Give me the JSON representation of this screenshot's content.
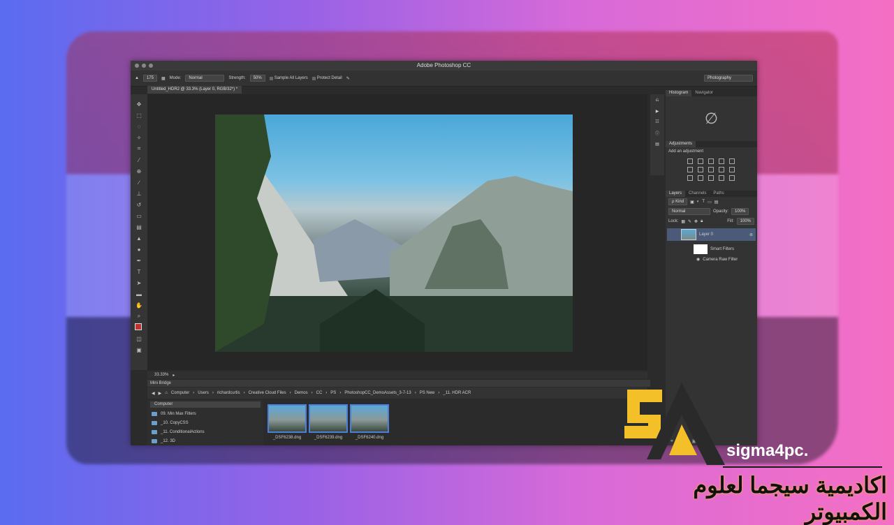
{
  "app": {
    "title": "Adobe Photoshop CC",
    "workspace": "Photography"
  },
  "options": {
    "brush_size": "175",
    "mode_label": "Mode:",
    "mode_value": "Normal",
    "strength_label": "Strength:",
    "strength_value": "50%",
    "sample_all_layers": "Sample All Layers",
    "protect_detail": "Protect Detail"
  },
  "document": {
    "tab": "Untitled_HDR2 @ 33.3% (Layer 0, RGB/32*) *",
    "zoom": "33.33%"
  },
  "mini_bridge": {
    "tab": "Mini Bridge",
    "path": [
      "Computer",
      "Users",
      "richardcurtis",
      "Creative Cloud Files",
      "Demos",
      "CC",
      "PS",
      "PhotoshopCC_DemoAssets_3-7-13",
      "PS New",
      "_11. HDR ACR"
    ],
    "source_header": "Computer",
    "folders": [
      "09. Min Max Filters",
      "_10. CopyCSS",
      "_11. ConditionalActions",
      "_12. 3D"
    ],
    "thumbnails": [
      "_DSF6238.dng",
      "_DSF6239.dng",
      "_DSF6240.dng"
    ]
  },
  "panels": {
    "top_tabs": [
      "Histogram",
      "Navigator"
    ],
    "hist_icon": "∅",
    "adjustments_tab": "Adjustments",
    "adjustments_hint": "Add an adjustment",
    "layer_tabs": [
      "Layers",
      "Channels",
      "Paths"
    ],
    "filter_kind": "ρ Kind",
    "blend_mode": "Normal",
    "opacity_label": "Opacity:",
    "opacity_value": "100%",
    "lock_label": "Lock:",
    "fill_label": "Fill:",
    "fill_value": "100%",
    "layers": {
      "layer0": "Layer 0",
      "smart_filters": "Smart Filters",
      "camera_raw": "Camera Raw Filter"
    }
  },
  "branding": {
    "site": "sigma4pc.",
    "arabic": "اكاديمية سيجما لعلوم الكمبيوتر",
    "logo_letters": "SA"
  },
  "colors": {
    "logo_yellow": "#f4c02a",
    "logo_dark": "#2a2a2a",
    "selection_blue": "#4b7fd8"
  }
}
